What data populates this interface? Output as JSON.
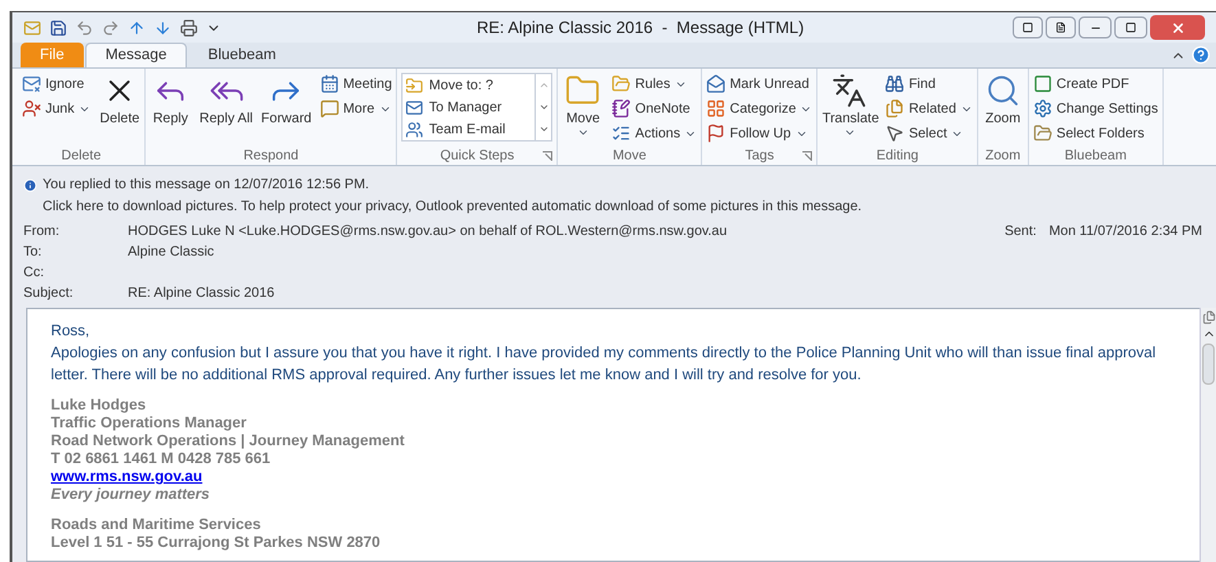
{
  "window": {
    "title": "RE: Alpine Classic 2016  -  Message (HTML)"
  },
  "tabs": [
    {
      "label": "File",
      "kind": "file",
      "selected": false
    },
    {
      "label": "Message",
      "kind": "tab",
      "selected": true
    },
    {
      "label": "Bluebeam",
      "kind": "tab",
      "selected": false
    }
  ],
  "ribbon": {
    "groups": [
      {
        "label": "Delete",
        "launcher": false,
        "columns": [
          {
            "kind": "stack",
            "items": [
              {
                "label": "Ignore",
                "dropdown": false
              },
              {
                "label": "Junk",
                "dropdown": true
              }
            ]
          },
          {
            "kind": "large",
            "items": [
              {
                "label": "Delete",
                "dropdown": false
              }
            ]
          }
        ]
      },
      {
        "label": "Respond",
        "launcher": false,
        "columns": [
          {
            "kind": "large",
            "items": [
              {
                "label": "Reply",
                "dropdown": false
              }
            ]
          },
          {
            "kind": "large",
            "items": [
              {
                "label": "Reply All",
                "dropdown": false
              }
            ]
          },
          {
            "kind": "large",
            "items": [
              {
                "label": "Forward",
                "dropdown": false
              }
            ]
          },
          {
            "kind": "stack",
            "items": [
              {
                "label": "Meeting",
                "dropdown": false
              },
              {
                "label": "More",
                "dropdown": true
              }
            ]
          }
        ]
      },
      {
        "label": "Quick Steps",
        "launcher": true,
        "columns": [
          {
            "kind": "gallery",
            "items": [
              {
                "label": "Move to: ?"
              },
              {
                "label": "To Manager"
              },
              {
                "label": "Team E-mail"
              }
            ]
          }
        ]
      },
      {
        "label": "Move",
        "launcher": false,
        "columns": [
          {
            "kind": "large",
            "items": [
              {
                "label": "Move",
                "dropdown": true
              }
            ]
          },
          {
            "kind": "stack",
            "items": [
              {
                "label": "Rules",
                "dropdown": true
              },
              {
                "label": "OneNote",
                "dropdown": false
              },
              {
                "label": "Actions",
                "dropdown": true
              }
            ]
          }
        ]
      },
      {
        "label": "Tags",
        "launcher": true,
        "columns": [
          {
            "kind": "stack",
            "items": [
              {
                "label": "Mark Unread",
                "dropdown": false
              },
              {
                "label": "Categorize",
                "dropdown": true
              },
              {
                "label": "Follow Up",
                "dropdown": true
              }
            ]
          }
        ]
      },
      {
        "label": "Editing",
        "launcher": false,
        "columns": [
          {
            "kind": "large",
            "items": [
              {
                "label": "Translate",
                "dropdown": true
              }
            ]
          },
          {
            "kind": "stack",
            "items": [
              {
                "label": "Find",
                "dropdown": false
              },
              {
                "label": "Related",
                "dropdown": true
              },
              {
                "label": "Select",
                "dropdown": true
              }
            ]
          }
        ]
      },
      {
        "label": "Zoom",
        "launcher": false,
        "columns": [
          {
            "kind": "large",
            "items": [
              {
                "label": "Zoom",
                "dropdown": false
              }
            ]
          }
        ]
      },
      {
        "label": "Bluebeam",
        "launcher": false,
        "columns": [
          {
            "kind": "stack",
            "items": [
              {
                "label": "Create PDF",
                "dropdown": false
              },
              {
                "label": "Change Settings",
                "dropdown": false
              },
              {
                "label": "Select Folders",
                "dropdown": false
              }
            ]
          }
        ]
      }
    ]
  },
  "infobar": [
    "You replied to this message on 12/07/2016 12:56 PM.",
    "Click here to download pictures. To help protect your privacy, Outlook prevented automatic download of some pictures in this message."
  ],
  "headers": [
    {
      "label": "From:",
      "value": "HODGES Luke N <Luke.HODGES@rms.nsw.gov.au> on behalf of ROL.Western@rms.nsw.gov.au"
    },
    {
      "label": "To:",
      "value": "Alpine Classic"
    },
    {
      "label": "Cc:"
    },
    {
      "label": "Subject:",
      "value": "RE: Alpine Classic 2016"
    }
  ],
  "sent": {
    "label": "Sent:",
    "value": "Mon 11/07/2016 2:34 PM"
  },
  "body": {
    "greeting": "Ross,",
    "paragraph": "Apologies on any confusion but I assure you that you have it right. I have provided my comments directly to the Police Planning Unit who will than issue final approval letter. There will be no additional RMS approval required. Any further issues let me know and I will try and resolve for you.",
    "signature": [
      {
        "kind": "line",
        "text": "Luke Hodges"
      },
      {
        "kind": "line",
        "text": "Traffic Operations Manager"
      },
      {
        "kind": "line",
        "text": "Road Network Operations | Journey Management"
      },
      {
        "kind": "plain",
        "text": "T 02 6861 1461 M 0428 785 661"
      },
      {
        "kind": "link",
        "text": "www.rms.nsw.gov.au"
      },
      {
        "kind": "tagline",
        "text": "Every journey matters"
      },
      {
        "kind": "gap"
      },
      {
        "kind": "line",
        "text": "Roads and Maritime Services"
      },
      {
        "kind": "line",
        "text": "Level 1 51 - 55 Currajong St Parkes NSW 2870"
      }
    ]
  }
}
